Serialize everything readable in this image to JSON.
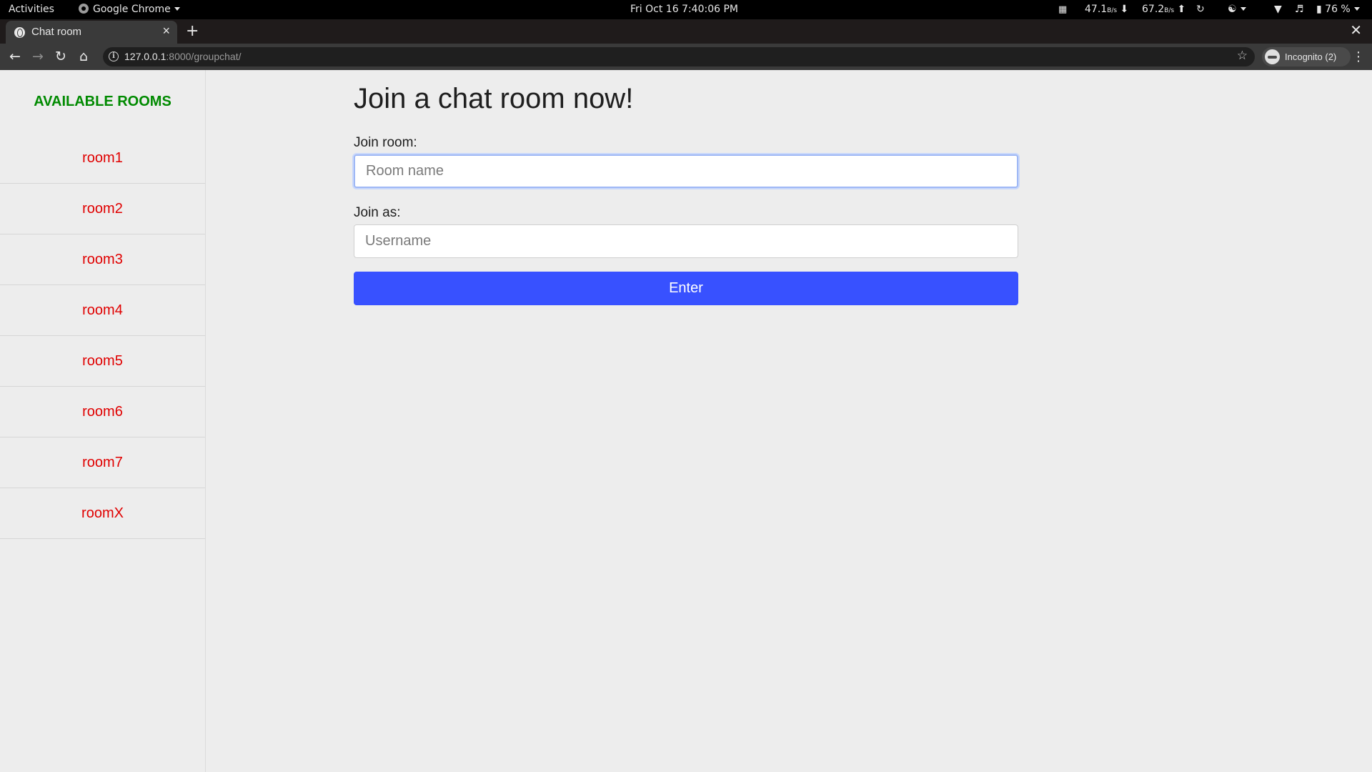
{
  "system_bar": {
    "activities": "Activities",
    "app_name": "Google Chrome",
    "clock": "Fri Oct 16  7:40:06 PM",
    "net_down": "47.1",
    "net_down_unit": "B/s",
    "net_up": "67.2",
    "net_up_unit": "B/s",
    "battery": "76 %"
  },
  "browser": {
    "tab_title": "Chat room",
    "url_host": "127.0.0.1",
    "url_rest": ":8000/groupchat/",
    "profile_label": "Incognito (2)"
  },
  "sidebar": {
    "title": "AVAILABLE ROOMS",
    "rooms": [
      "room1",
      "room2",
      "room3",
      "room4",
      "room5",
      "room6",
      "room7",
      "roomX"
    ]
  },
  "form": {
    "heading": "Join a chat room now!",
    "room_label": "Join room:",
    "room_placeholder": "Room name",
    "username_label": "Join as:",
    "username_placeholder": "Username",
    "submit_label": "Enter"
  },
  "colors": {
    "sidebar_title": "#008a00",
    "room_link": "#e00000",
    "enter_button": "#3851ff",
    "page_bg": "#ededed"
  }
}
